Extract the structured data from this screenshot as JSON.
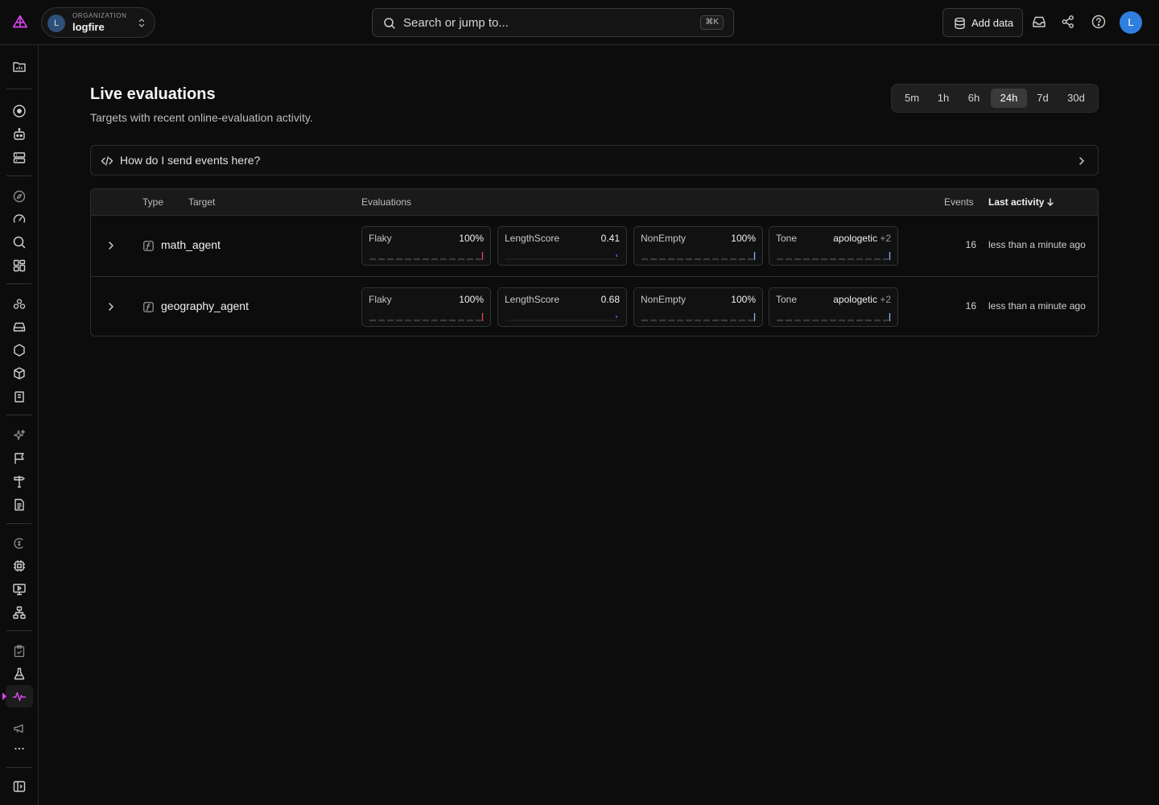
{
  "org": {
    "caption": "ORGANIZATION",
    "name": "logfire",
    "initial": "L"
  },
  "search": {
    "placeholder": "Search or jump to...",
    "shortcut": "⌘K"
  },
  "toolbar": {
    "add_data_label": "Add data"
  },
  "user": {
    "initial": "L"
  },
  "page": {
    "title": "Live evaluations",
    "subtitle": "Targets with recent online-evaluation activity."
  },
  "time_range": {
    "options": [
      "5m",
      "1h",
      "6h",
      "24h",
      "7d",
      "30d"
    ],
    "selected": "24h"
  },
  "help": {
    "label": "How do I send events here?"
  },
  "table": {
    "headers": {
      "type": "Type",
      "target": "Target",
      "evaluations": "Evaluations",
      "events": "Events",
      "last_activity": "Last activity"
    },
    "rows": [
      {
        "target": "math_agent",
        "events": "16",
        "last_activity": "less than a minute ago",
        "evaluations": [
          {
            "name": "Flaky",
            "value": "100%",
            "extra": ""
          },
          {
            "name": "LengthScore",
            "value": "0.41",
            "extra": ""
          },
          {
            "name": "NonEmpty",
            "value": "100%",
            "extra": ""
          },
          {
            "name": "Tone",
            "value": "apologetic",
            "extra": "+2"
          }
        ]
      },
      {
        "target": "geography_agent",
        "events": "16",
        "last_activity": "less than a minute ago",
        "evaluations": [
          {
            "name": "Flaky",
            "value": "100%",
            "extra": ""
          },
          {
            "name": "LengthScore",
            "value": "0.68",
            "extra": ""
          },
          {
            "name": "NonEmpty",
            "value": "100%",
            "extra": ""
          },
          {
            "name": "Tone",
            "value": "apologetic",
            "extra": "+2"
          }
        ]
      }
    ]
  },
  "colors": {
    "accent": "#d946ef",
    "avatar": "#2f7fe0",
    "spark_red": "#e5484d",
    "spark_blue": "#3b82f6"
  }
}
